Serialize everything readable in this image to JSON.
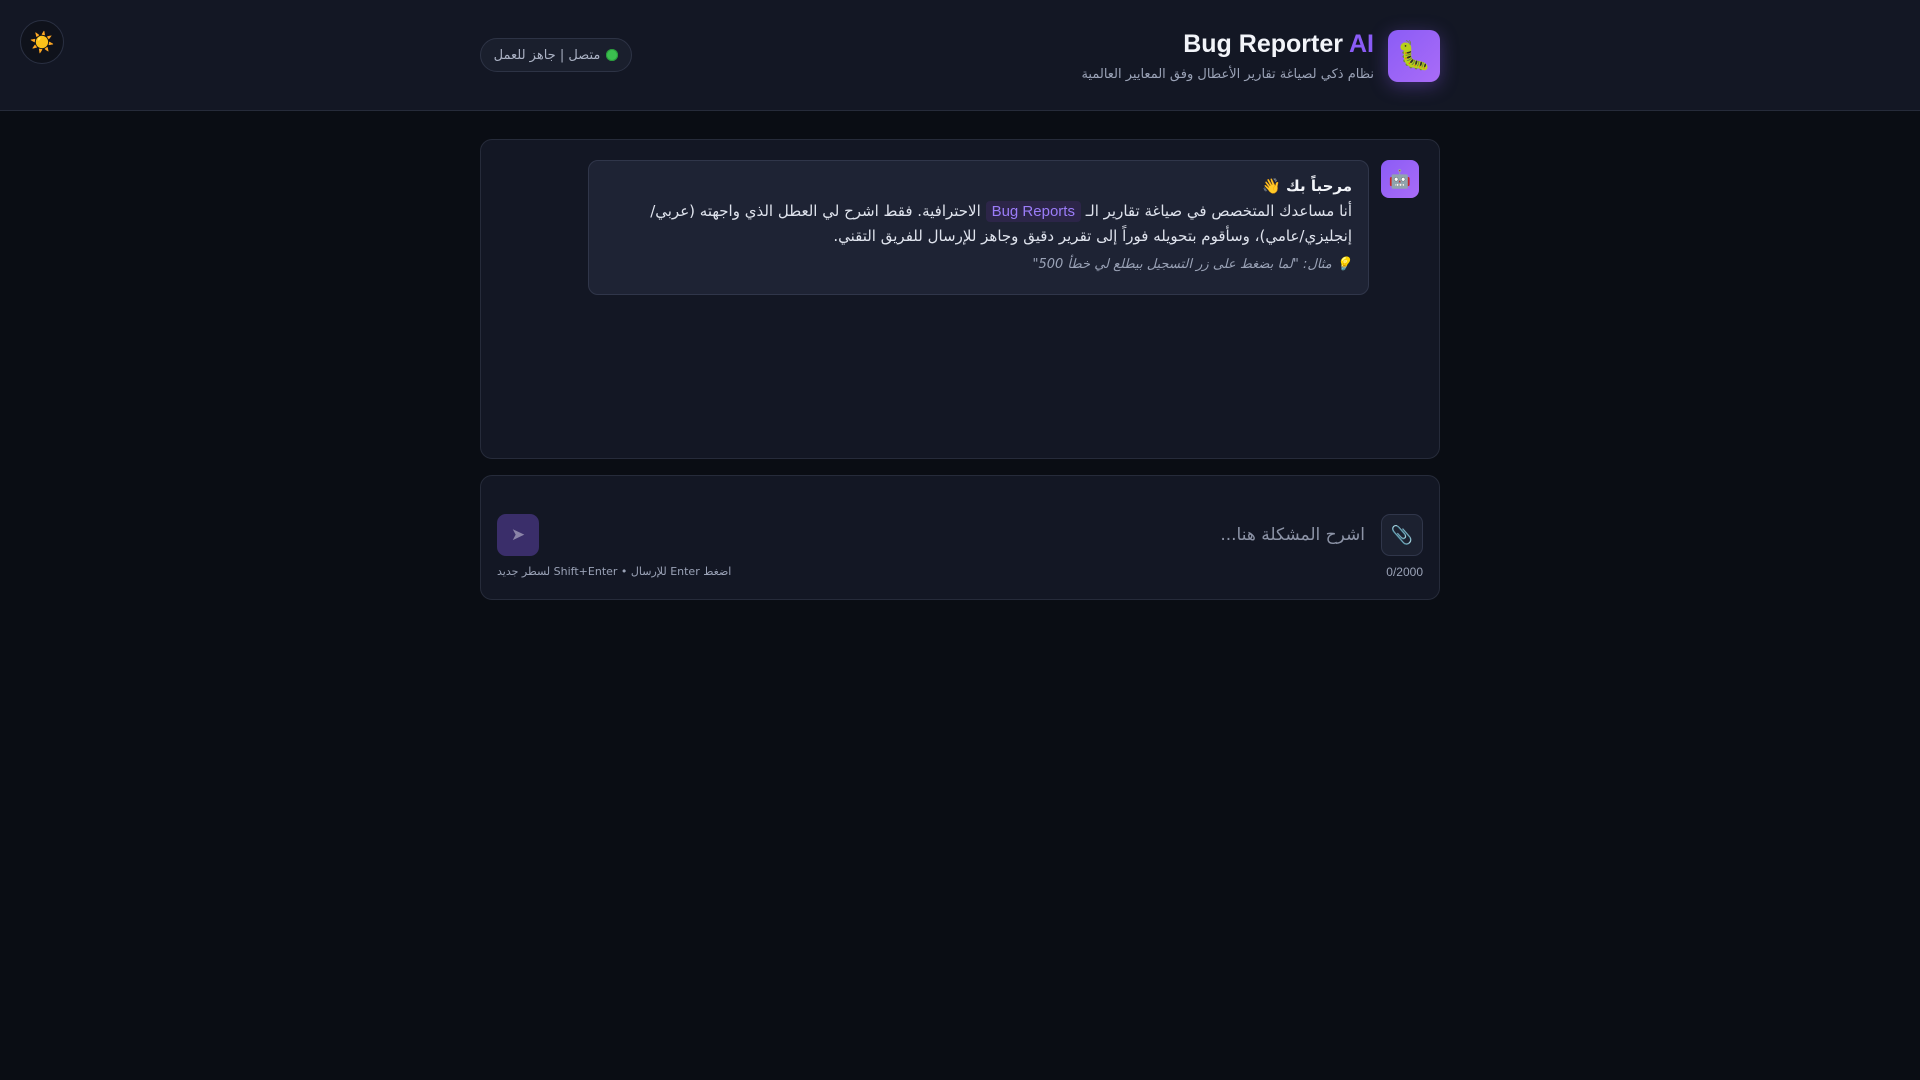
{
  "theme_toggle": {
    "icon": "sun-icon",
    "glyph": "☀️"
  },
  "header": {
    "title_main": "Bug Reporter",
    "title_accent": "AI",
    "subtitle": "نظام ذكي لصياغة تقارير الأعطال وفق المعايير العالمية",
    "logo_icon": "bug-icon",
    "logo_glyph": "🐛",
    "status": "متصل | جاهز للعمل",
    "status_color": "#3bbf4f"
  },
  "chat": {
    "bot_avatar_glyph": "🤖",
    "greeting": "مرحباً بك 👋",
    "body_part1": "أنا مساعدك المتخصص في صياغة تقارير الـ",
    "body_tag": "Bug Reports",
    "body_part2": "الاحترافية. فقط اشرح لي العطل الذي واجهته (عربي/إنجليزي/عامي)، وسأقوم بتحويله فوراً إلى تقرير دقيق وجاهز للإرسال للفريق التقني.",
    "hint": "💡 مثال: \"لما بضغط على زر التسجيل بيطلع لي خطأ 500\""
  },
  "composer": {
    "placeholder": "اشرح المشكلة هنا...",
    "value": "",
    "char_count": "0/2000",
    "hint": "اضغط Enter للإرسال • Shift+Enter لسطر جديد",
    "attach_glyph": "📎",
    "send_glyph": "➤"
  },
  "colors": {
    "accent": "#8b5cf6",
    "background": "#0a0d14",
    "panel": "#131724"
  }
}
